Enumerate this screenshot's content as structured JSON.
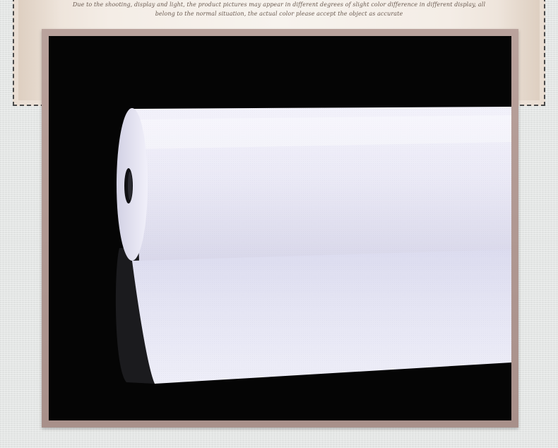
{
  "notice": {
    "text": "Due to the shooting, display and light, the product pictures may appear in different degrees of slight color difference in different display, all belong to the normal situation, the actual color please accept the object as accurate"
  },
  "photo": {
    "subject": "white-paper-roll",
    "colors": {
      "background": "#050505",
      "frame": "#b09892",
      "roll_surface": "#ebeaf7",
      "notice_text": "#6a5a50"
    }
  }
}
